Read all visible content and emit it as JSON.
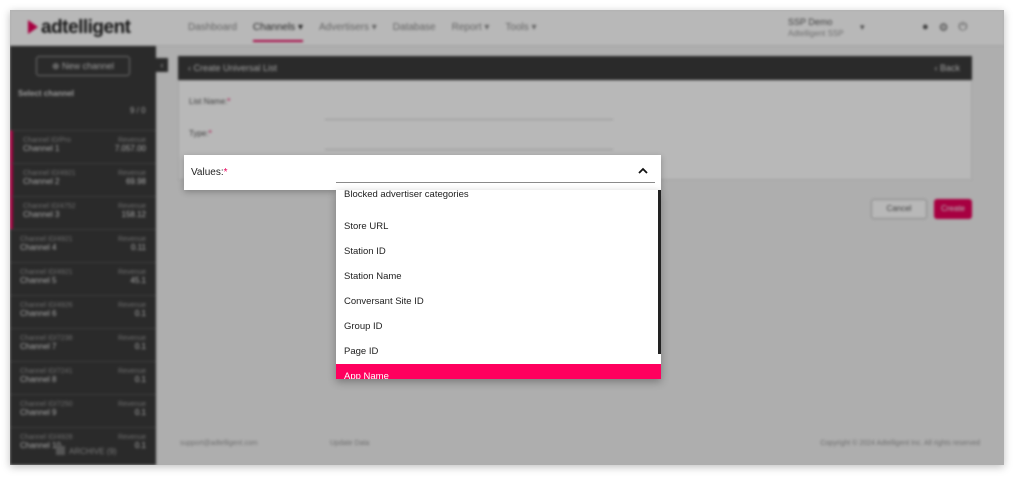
{
  "app": {
    "logo_text": "adtelligent",
    "nav": [
      "Dashboard",
      "Channels ▾",
      "Advertisers ▾",
      "Database",
      "Report ▾",
      "Tools ▾"
    ],
    "account_name": "SSP Demo",
    "account_sub": "Adtelligent SSP"
  },
  "sidebar": {
    "new_channel": "⊕ New channel",
    "select_channel": "Select channel",
    "count": "9 / 0",
    "channels": [
      {
        "id": "Channel ID/Pro",
        "name": "Channel 1",
        "rev_label": "Revenue",
        "rev": "7.057.00"
      },
      {
        "id": "Channel ID/4921",
        "name": "Channel 2",
        "rev_label": "Revenue",
        "rev": "69.98"
      },
      {
        "id": "Channel ID/4752",
        "name": "Channel 3",
        "rev_label": "Revenue",
        "rev": "158.12"
      },
      {
        "id": "Channel ID/4921",
        "name": "Channel 4",
        "rev_label": "Revenue",
        "rev": "0.11"
      },
      {
        "id": "Channel ID/4921",
        "name": "Channel 5",
        "rev_label": "Revenue",
        "rev": "45.1"
      },
      {
        "id": "Channel ID/4926",
        "name": "Channel 6",
        "rev_label": "Revenue",
        "rev": "0.1"
      },
      {
        "id": "Channel ID/7238",
        "name": "Channel 7",
        "rev_label": "Revenue",
        "rev": "0.1"
      },
      {
        "id": "Channel ID/7241",
        "name": "Channel 8",
        "rev_label": "Revenue",
        "rev": "0.1"
      },
      {
        "id": "Channel ID/7250",
        "name": "Channel 9",
        "rev_label": "Revenue",
        "rev": "0.1"
      },
      {
        "id": "Channel ID/4928",
        "name": "Channel 10",
        "rev_label": "Revenue",
        "rev": "0.1"
      }
    ],
    "archive": "ARCHIVE (9)"
  },
  "panel": {
    "title": "‹  Create Universal List",
    "back": "‹  Back",
    "list_name_label": "List Name:",
    "type_label": "Type:",
    "cancel": "Cancel",
    "create": "Create"
  },
  "footer": {
    "email": "support@adtelligent.com",
    "phone": "Update Data",
    "copyright": "Copyright © 2024 Adtelligent Inc. All rights reserved"
  },
  "values_field": {
    "label": "Values:",
    "required_mark": "*",
    "chevron_icon": "chevron-up-icon"
  },
  "dropdown": {
    "options": [
      "Blocked advertiser categories",
      "Store URL",
      "Station ID",
      "Station Name",
      "Conversant Site ID",
      "Group ID",
      "Page ID",
      "App Name"
    ],
    "highlighted": "App Name"
  },
  "colors": {
    "accent": "#ff005e",
    "sidebar": "#3b3b3b"
  }
}
